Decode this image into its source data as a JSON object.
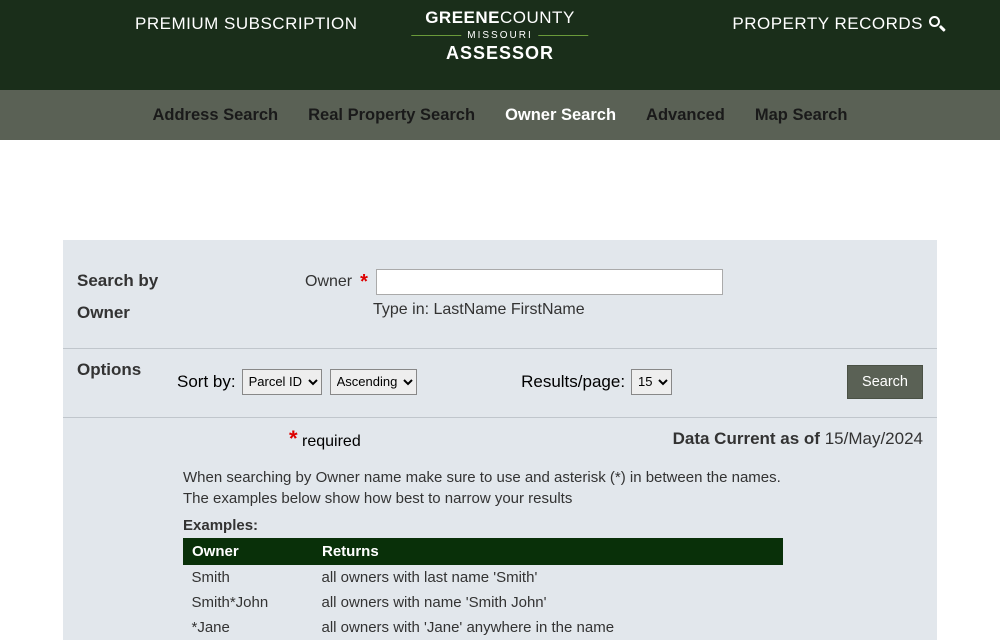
{
  "topbar": {
    "premium": "PREMIUM SUBSCRIPTION",
    "logo_greene": "GREENE",
    "logo_county": "COUNTY",
    "logo_state": "MISSOURI",
    "logo_role": "ASSESSOR",
    "property_records": "PROPERTY RECORDS"
  },
  "nav": {
    "address": "Address Search",
    "real": "Real Property Search",
    "owner": "Owner Search",
    "advanced": "Advanced",
    "map": "Map Search"
  },
  "panel": {
    "search_by": "Search by",
    "owner": "Owner",
    "owner_label": "Owner",
    "owner_hint": "Type in: LastName FirstName",
    "options": "Options",
    "sort_by": "Sort by:",
    "sort_field": "Parcel ID",
    "sort_dir": "Ascending",
    "results_page": "Results/page:",
    "results_val": "15",
    "search_btn": "Search",
    "required": "required",
    "data_current_label": "Data Current as of ",
    "data_current_date": "15/May/2024"
  },
  "examples": {
    "p1": "When searching by Owner name make sure to use and asterisk (*) in between the names.",
    "p2": "The examples below show how best to narrow your results",
    "hdr": "Examples:",
    "col_owner": "Owner",
    "col_returns": "Returns",
    "rows": [
      {
        "o": "Smith",
        "r": "all owners with last name 'Smith'"
      },
      {
        "o": "Smith*John",
        "r": "all owners with name 'Smith John'"
      },
      {
        "o": "*Jane",
        "r": "all owners with 'Jane' anywhere in the name"
      }
    ]
  }
}
